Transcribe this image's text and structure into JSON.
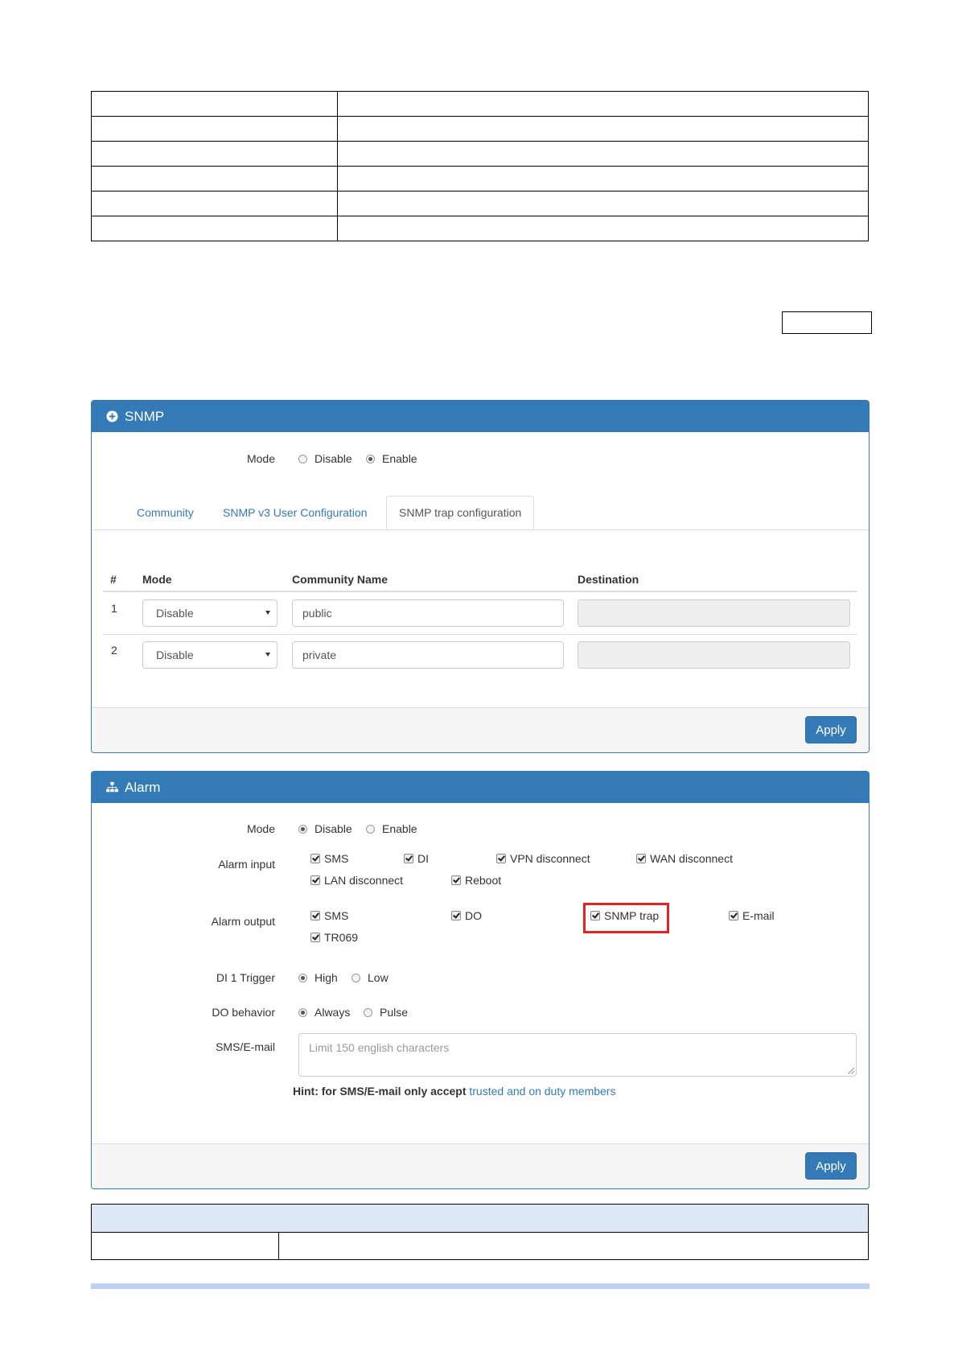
{
  "snmp_panel": {
    "title": "SNMP",
    "mode_label": "Mode",
    "mode_options": [
      "Disable",
      "Enable"
    ],
    "mode_selected": "Enable",
    "tabs": [
      "Community",
      "SNMP v3 User Configuration",
      "SNMP trap configuration"
    ],
    "active_tab": "SNMP trap configuration",
    "table": {
      "headers": [
        "#",
        "Mode",
        "Community Name",
        "Destination"
      ],
      "rows": [
        {
          "index": "1",
          "mode": "Disable",
          "community_name": "public",
          "destination": ""
        },
        {
          "index": "2",
          "mode": "Disable",
          "community_name": "private",
          "destination": ""
        }
      ]
    },
    "apply_label": "Apply"
  },
  "alarm_panel": {
    "title": "Alarm",
    "mode_label": "Mode",
    "mode_options": [
      "Disable",
      "Enable"
    ],
    "mode_selected": "Disable",
    "alarm_input_label": "Alarm input",
    "alarm_input_options": [
      "SMS",
      "DI",
      "VPN disconnect",
      "WAN disconnect",
      "LAN disconnect",
      "Reboot"
    ],
    "alarm_output_label": "Alarm output",
    "alarm_output_options": [
      "SMS",
      "DO",
      "SNMP trap",
      "E-mail",
      "TR069"
    ],
    "highlighted_option": "SNMP trap",
    "di_trigger_label": "DI 1 Trigger",
    "di_trigger_options": [
      "High",
      "Low"
    ],
    "di_trigger_selected": "High",
    "do_behavior_label": "DO behavior",
    "do_behavior_options": [
      "Always",
      "Pulse"
    ],
    "do_behavior_selected": "Always",
    "sms_email_label": "SMS/E-mail",
    "sms_email_placeholder": "Limit 150 english characters",
    "hint_bold": "Hint: for SMS/E-mail only accept",
    "hint_link": "trusted and on duty members",
    "apply_label": "Apply"
  },
  "colors": {
    "panel_header": "#337ab7",
    "highlight": "#e52421",
    "table_header_fill": "#dde8f7",
    "bottom_bar": "#bcd0f3"
  }
}
